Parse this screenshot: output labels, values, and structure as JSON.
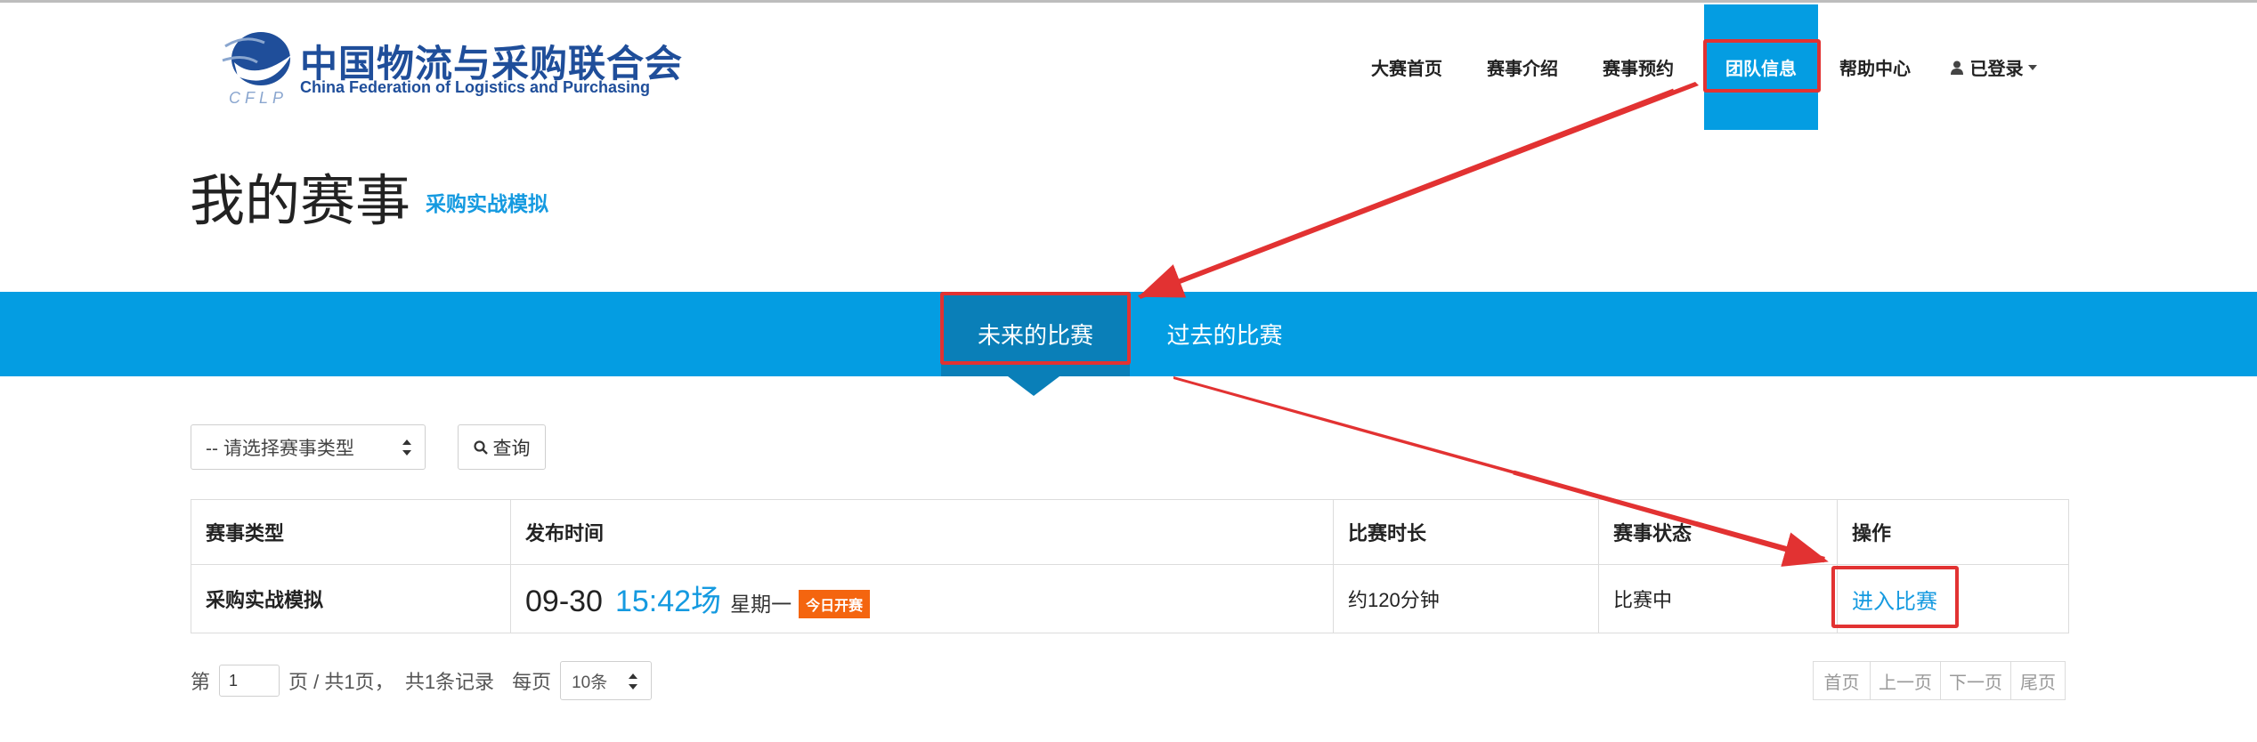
{
  "logo": {
    "name_cn": "中国物流与采购联合会",
    "name_en": "China Federation of Logistics and Purchasing",
    "abbr": "CFLP",
    "brand_color": "#1f4e9a"
  },
  "nav": {
    "items": [
      {
        "label": "大赛首页"
      },
      {
        "label": "赛事介绍"
      },
      {
        "label": "赛事预约"
      },
      {
        "label": "团队信息",
        "active": true
      },
      {
        "label": "帮助中心"
      }
    ],
    "user": {
      "label": "已登录",
      "icon": "user-icon"
    },
    "active_color": "#049de2"
  },
  "page": {
    "title": "我的赛事",
    "subtitle": "采购实战模拟"
  },
  "tabs": [
    {
      "label": "未来的比赛",
      "active": true
    },
    {
      "label": "过去的比赛"
    }
  ],
  "filter": {
    "select_value": "-- 请选择赛事类型",
    "query_label": "查询"
  },
  "table": {
    "headers": [
      "赛事类型",
      "发布时间",
      "比赛时长",
      "赛事状态",
      "操作"
    ],
    "rows": [
      {
        "type": "采购实战模拟",
        "date": "09-30",
        "time": "15:42场",
        "weekday": "星期一",
        "badge": "今日开赛",
        "duration": "约120分钟",
        "status": "比赛中",
        "action": "进入比赛"
      }
    ]
  },
  "pagination": {
    "prefix": "第",
    "page": "1",
    "summary": "页 / 共1页，  共1条记录",
    "per_page_label": "每页",
    "per_page_value": "10条",
    "buttons": [
      "首页",
      "上一页",
      "下一页",
      "尾页"
    ]
  },
  "colors": {
    "accent": "#049de2",
    "tab_active": "#0a7fb8",
    "link": "#159ae0",
    "badge": "#f4650f",
    "annotation": "#e23232"
  }
}
